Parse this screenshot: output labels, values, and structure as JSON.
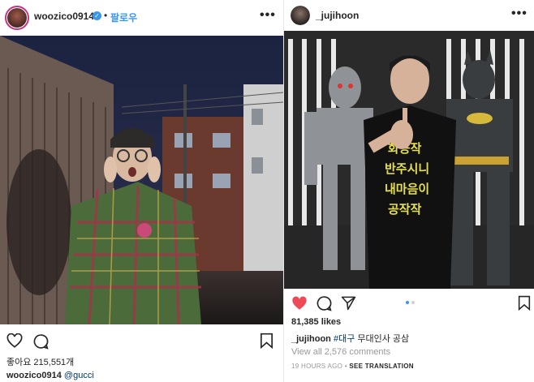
{
  "left_post": {
    "username": "woozico0914",
    "verified": true,
    "separator": "•",
    "follow_label": "팔로우",
    "more_label": "•••",
    "likes_label": "좋아요 215,551개",
    "caption_user": "woozico0914",
    "caption_text": "@gucci"
  },
  "right_post": {
    "username": "_jujihoon",
    "more_label": "•••",
    "likes_label": "81,385 likes",
    "caption_user": "_jujihoon",
    "caption_hashtag": "#대구",
    "caption_text": "무대인사 공삼",
    "view_comments": "View all 2,576 comments",
    "time_ago": "19 HOURS AGO",
    "time_separator": "•",
    "see_translation": "SEE TRANSLATION",
    "shirt_text": [
      "화공작",
      "반주시니",
      "내마음이",
      "공작작"
    ]
  },
  "icons": {
    "left_actions": [
      "heart-outline-icon",
      "comment-icon",
      "bookmark-icon"
    ],
    "right_actions": [
      "heart-filled-icon",
      "comment-icon",
      "share-icon",
      "bookmark-icon"
    ]
  },
  "colors": {
    "like_red": "#ed4956",
    "link_blue": "#3897f0",
    "hashtag_blue": "#003569",
    "text": "#262626",
    "muted": "#999999"
  }
}
